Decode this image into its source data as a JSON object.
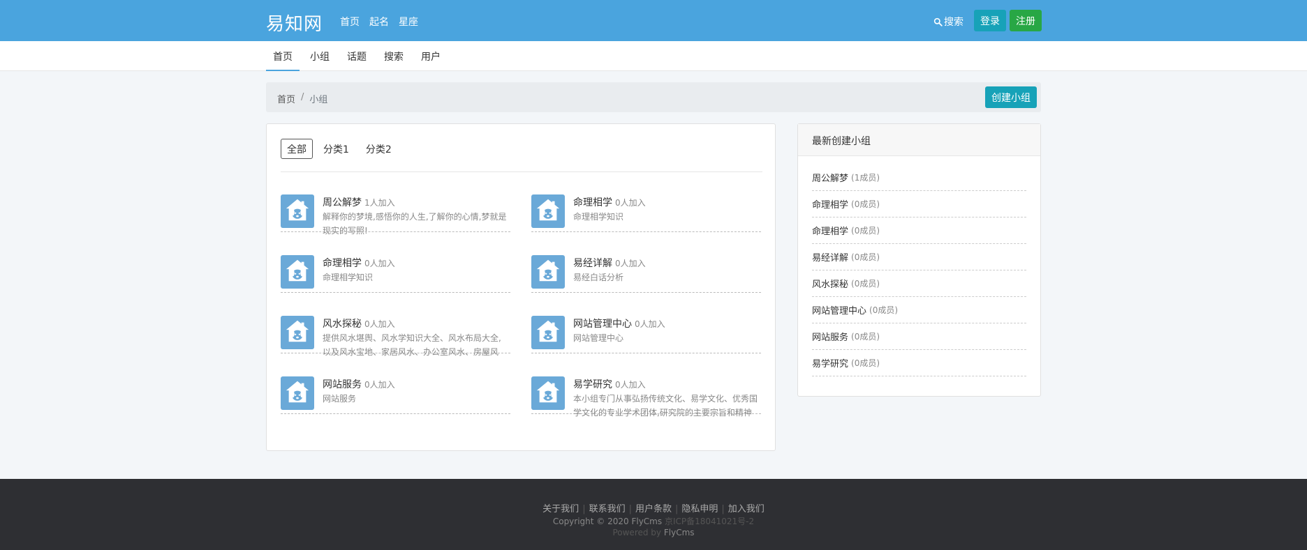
{
  "header": {
    "logo": "易知网",
    "nav": [
      "首页",
      "起名",
      "星座"
    ],
    "search_label": "搜索",
    "login_label": "登录",
    "register_label": "注册"
  },
  "subnav": {
    "items": [
      "首页",
      "小组",
      "话题",
      "搜索",
      "用户"
    ],
    "active_index": 0
  },
  "breadcrumb": {
    "home": "首页",
    "separator": "/",
    "current": "小组",
    "create_label": "创建小组"
  },
  "tabs": {
    "items": [
      "全部",
      "分类1",
      "分类2"
    ],
    "active_index": 0
  },
  "groups": [
    {
      "name": "周公解梦",
      "members": "1人加入",
      "desc": "解释你的梦境,感悟你的人生,了解你的心情,梦就是现实的写照!"
    },
    {
      "name": "命理相学",
      "members": "0人加入",
      "desc": "命理相学知识"
    },
    {
      "name": "命理相学",
      "members": "0人加入",
      "desc": "命理相学知识"
    },
    {
      "name": "易经详解",
      "members": "0人加入",
      "desc": "易经白话分析"
    },
    {
      "name": "风水探秘",
      "members": "0人加入",
      "desc": "提供风水堪舆、风水学知识大全、风水布局大全,以及风水宝地、家居风水、办公室风水、房屋风水、商店风水、商铺风水、楼盘风水中全等内容"
    },
    {
      "name": "网站管理中心",
      "members": "0人加入",
      "desc": "网站管理中心"
    },
    {
      "name": "网站服务",
      "members": "0人加入",
      "desc": "网站服务"
    },
    {
      "name": "易学研究",
      "members": "0人加入",
      "desc": "本小组专门从事弘扬传统文化、易学文化、优秀国学文化的专业学术团体,研究院的主要宗旨和精神是服务社会大众以精神文明和物质文明的建设"
    }
  ],
  "sidebar": {
    "title": "最新创建小组",
    "items": [
      {
        "name": "周公解梦",
        "count": "(1成员)"
      },
      {
        "name": "命理相学",
        "count": "(0成员)"
      },
      {
        "name": "命理相学",
        "count": "(0成员)"
      },
      {
        "name": "易经详解",
        "count": "(0成员)"
      },
      {
        "name": "风水探秘",
        "count": "(0成员)"
      },
      {
        "name": "网站管理中心",
        "count": "(0成员)"
      },
      {
        "name": "网站服务",
        "count": "(0成员)"
      },
      {
        "name": "易学研究",
        "count": "(0成员)"
      }
    ]
  },
  "footer": {
    "links": [
      "关于我们",
      "联系我们",
      "用户条款",
      "隐私申明",
      "加入我们"
    ],
    "copyright": "Copyright © 2020 FlyCms",
    "icp": "京ICP备18041021号-2",
    "powered_prefix": "Powered by",
    "powered_brand": "FlyCms"
  },
  "icons": {
    "search": "search-icon",
    "group_avatar": "house-dog-icon"
  },
  "colors": {
    "header_bg": "#4aa4de",
    "info_button": "#17a2b8",
    "success_button": "#28a745",
    "footer_bg": "#2e2f33"
  }
}
